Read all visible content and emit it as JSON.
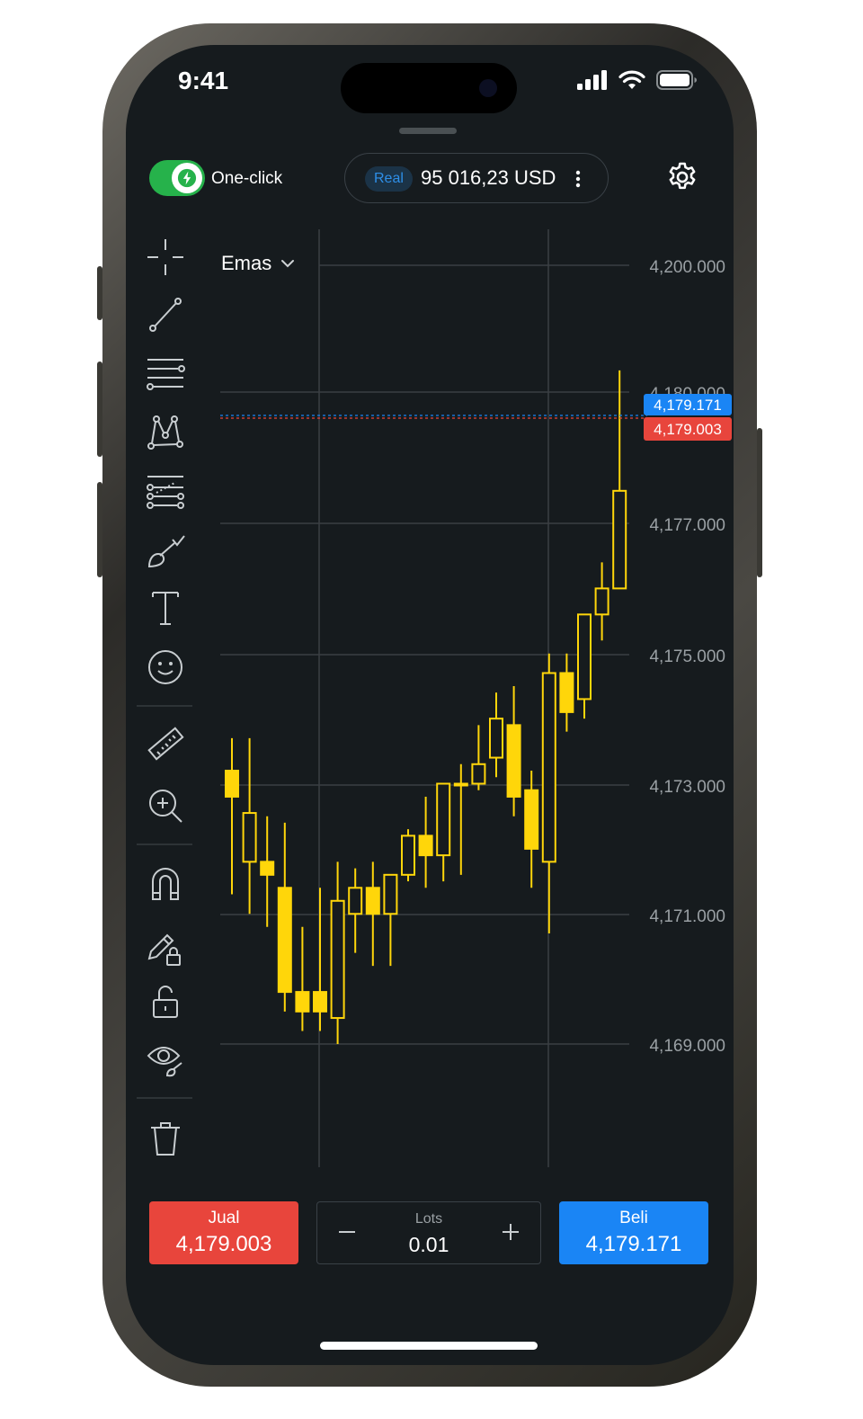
{
  "status_bar": {
    "time": "9:41"
  },
  "header": {
    "one_click_label": "One-click",
    "one_click_on": true,
    "account_type": "Real",
    "balance": "95 016,23 USD"
  },
  "chart": {
    "symbol": "Emas",
    "price_axis": [
      "4,200.000",
      "4,180.000",
      "4,177.000",
      "4,175.000",
      "4,173.000",
      "4,171.000",
      "4,169.000"
    ],
    "ask_label": "4,179.171",
    "bid_label": "4,179.003",
    "colors": {
      "candle": "#ffd60a",
      "ask": "#1a85f5",
      "bid": "#e8453c",
      "grid": "#3a3f43",
      "background": "#161b1e"
    }
  },
  "chart_data": {
    "type": "candlestick",
    "ylim": [
      4168.5,
      4201
    ],
    "y_ticks": [
      4200.0,
      4180.0,
      4177.0,
      4175.0,
      4173.0,
      4171.0,
      4169.0
    ],
    "grid": true,
    "ask": 4179.171,
    "bid": 4179.003,
    "candles": [
      {
        "o": 4173.2,
        "h": 4173.7,
        "l": 4171.3,
        "c": 4172.8
      },
      {
        "o": 4171.8,
        "h": 4173.7,
        "l": 4171.0,
        "c": 4172.55
      },
      {
        "o": 4171.8,
        "h": 4172.5,
        "l": 4170.8,
        "c": 4171.6
      },
      {
        "o": 4171.4,
        "h": 4172.4,
        "l": 4169.5,
        "c": 4169.8
      },
      {
        "o": 4169.8,
        "h": 4170.8,
        "l": 4169.2,
        "c": 4169.5
      },
      {
        "o": 4169.8,
        "h": 4171.4,
        "l": 4169.2,
        "c": 4169.5
      },
      {
        "o": 4169.4,
        "h": 4171.8,
        "l": 4169.0,
        "c": 4171.2
      },
      {
        "o": 4171.0,
        "h": 4171.7,
        "l": 4170.4,
        "c": 4171.4
      },
      {
        "o": 4171.4,
        "h": 4171.8,
        "l": 4170.2,
        "c": 4171.0
      },
      {
        "o": 4171.0,
        "h": 4171.6,
        "l": 4170.2,
        "c": 4171.6
      },
      {
        "o": 4171.6,
        "h": 4172.3,
        "l": 4171.5,
        "c": 4172.2
      },
      {
        "o": 4172.2,
        "h": 4172.8,
        "l": 4171.4,
        "c": 4171.9
      },
      {
        "o": 4171.9,
        "h": 4173.0,
        "l": 4171.5,
        "c": 4173.0
      },
      {
        "o": 4173.0,
        "h": 4173.3,
        "l": 4171.6,
        "c": 4173.0
      },
      {
        "o": 4173.0,
        "h": 4173.9,
        "l": 4172.9,
        "c": 4173.3
      },
      {
        "o": 4173.4,
        "h": 4174.4,
        "l": 4173.1,
        "c": 4174.0
      },
      {
        "o": 4173.9,
        "h": 4174.5,
        "l": 4172.5,
        "c": 4172.8
      },
      {
        "o": 4172.9,
        "h": 4173.2,
        "l": 4171.4,
        "c": 4172.0
      },
      {
        "o": 4171.8,
        "h": 4175.0,
        "l": 4170.7,
        "c": 4174.7
      },
      {
        "o": 4174.7,
        "h": 4175.0,
        "l": 4173.8,
        "c": 4174.1
      },
      {
        "o": 4174.3,
        "h": 4175.6,
        "l": 4174.0,
        "c": 4175.6
      },
      {
        "o": 4175.6,
        "h": 4176.4,
        "l": 4175.2,
        "c": 4176.0
      },
      {
        "o": 4176.0,
        "h": 4179.35,
        "l": 4176.0,
        "c": 4177.5
      }
    ]
  },
  "toolbar": {
    "items": [
      {
        "icon": "crosshair-icon"
      },
      {
        "icon": "trend-line-icon"
      },
      {
        "icon": "horizontal-lines-icon"
      },
      {
        "icon": "pattern-icon"
      },
      {
        "icon": "fibonacci-icon"
      },
      {
        "icon": "brush-icon"
      },
      {
        "icon": "text-icon"
      },
      {
        "icon": "emoji-icon"
      },
      {
        "icon": "ruler-icon"
      },
      {
        "icon": "zoom-in-icon"
      },
      {
        "icon": "magnet-icon"
      },
      {
        "icon": "lock-drawing-icon"
      },
      {
        "icon": "unlock-icon"
      },
      {
        "icon": "hide-drawings-icon"
      },
      {
        "icon": "trash-icon"
      }
    ]
  },
  "trade": {
    "sell_label": "Jual",
    "sell_price": "4,179.003",
    "lots_label": "Lots",
    "lots_value": "0.01",
    "buy_label": "Beli",
    "buy_price": "4,179.171"
  }
}
